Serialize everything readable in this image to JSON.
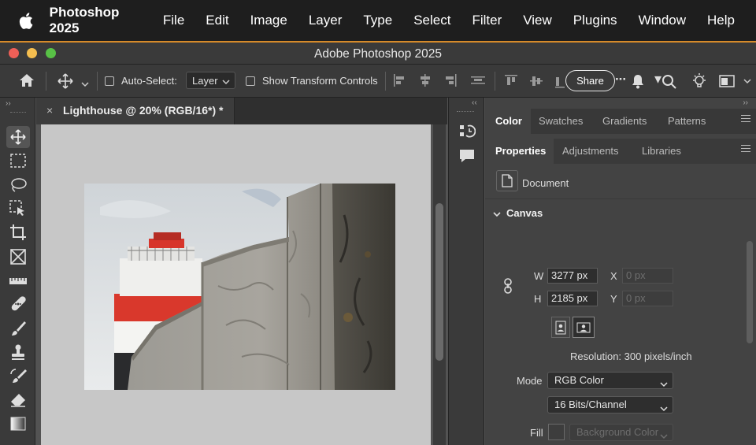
{
  "menubar": {
    "app_name": "Photoshop 2025",
    "items": [
      "File",
      "Edit",
      "Image",
      "Layer",
      "Type",
      "Select",
      "Filter",
      "View",
      "Plugins",
      "Window",
      "Help"
    ]
  },
  "window": {
    "title": "Adobe Photoshop 2025"
  },
  "options_bar": {
    "auto_select_label": "Auto-Select:",
    "auto_select_value": "Layer",
    "show_transform_label": "Show Transform Controls",
    "share_label": "Share",
    "more_icon": "···"
  },
  "document": {
    "tab_title": "Lighthouse @ 20% (RGB/16*) *",
    "close_glyph": "×"
  },
  "panels": {
    "top_tabs": [
      "Color",
      "Swatches",
      "Gradients",
      "Patterns"
    ],
    "second_tabs": [
      "Properties",
      "Adjustments",
      "Libraries"
    ],
    "document_label": "Document",
    "canvas_section": "Canvas",
    "width_label": "W",
    "width_value": "3277 px",
    "height_label": "H",
    "height_value": "2185 px",
    "x_label": "X",
    "x_placeholder": "0 px",
    "y_label": "Y",
    "y_placeholder": "0 px",
    "resolution": "Resolution: 300 pixels/inch",
    "mode_label": "Mode",
    "mode_value": "RGB Color",
    "depth_value": "16 Bits/Channel",
    "fill_label": "Fill",
    "fill_value": "Background Color"
  },
  "colors": {
    "accent_border": "#d58a2a",
    "close_red": "#ee5f57",
    "minimize_yellow": "#f5be4f",
    "zoom_green": "#58c146"
  },
  "icons": [
    "apple-icon",
    "home-icon",
    "move-icon",
    "marquee-icon",
    "lasso-icon",
    "object-select-icon",
    "crop-icon",
    "frame-icon",
    "ruler-icon",
    "healing-icon",
    "brush-icon",
    "stamp-icon",
    "history-brush-icon",
    "eraser-icon",
    "gradient-icon",
    "bell-icon",
    "search-icon",
    "lightbulb-icon",
    "workspace-icon",
    "history-icon",
    "comment-icon",
    "link-icon",
    "document-icon"
  ]
}
